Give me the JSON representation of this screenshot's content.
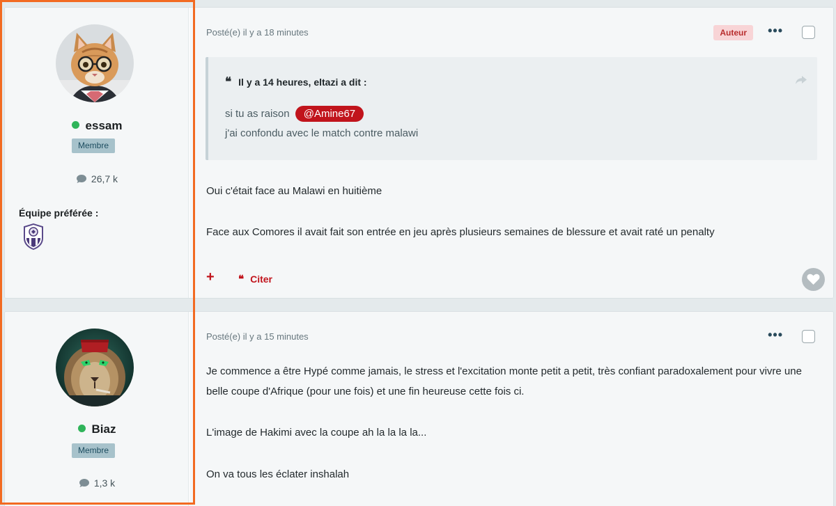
{
  "colors": {
    "accent": "#c1141c",
    "online": "#2fb45a",
    "highlight_border": "#f26a21",
    "badge_bg": "#a7c2cb"
  },
  "posts": [
    {
      "author": {
        "name": "essam",
        "group": "Membre",
        "post_count": "26,7 k",
        "favorite_team_label": "Équipe préférée :",
        "favorite_team_icon": "team-crest-icon"
      },
      "posted": "Posté(e) il y a 18 minutes",
      "author_badge": "Auteur",
      "quote": {
        "header": "Il y a 14 heures, eltazi a dit :",
        "line1": "si tu as raison",
        "mention": "@Amine67",
        "line2": "j'ai confondu avec le match contre malawi"
      },
      "paragraphs": [
        "Oui c'était face au Malawi en huitième",
        "Face aux Comores il avait fait son entrée en jeu après plusieurs semaines de blessure et avait raté un penalty"
      ],
      "actions": {
        "add": "+",
        "quote_label": "Citer"
      }
    },
    {
      "author": {
        "name": "Biaz",
        "group": "Membre",
        "post_count": "1,3 k"
      },
      "posted": "Posté(e) il y a 15 minutes",
      "paragraphs": [
        "Je commence a être Hypé comme jamais, le stress et l'excitation monte petit a petit, très confiant paradoxalement pour vivre une belle coupe d'Afrique (pour une fois) et une fin heureuse cette fois ci.",
        "L'image de Hakimi avec la coupe ah la la la la...",
        "On va tous les éclater inshalah"
      ]
    }
  ]
}
